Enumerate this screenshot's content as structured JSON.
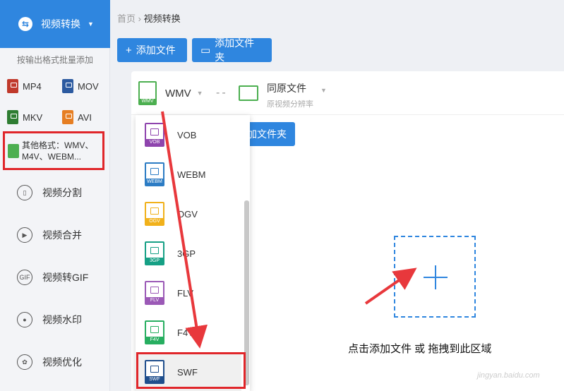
{
  "sidebar": {
    "top_label": "视频转换",
    "hint": "按输出格式批量添加",
    "formats": [
      {
        "label": "MP4",
        "icon": "mp4-icon",
        "color": "#c0392b"
      },
      {
        "label": "MOV",
        "icon": "mov-icon",
        "color": "#2c5aa0"
      },
      {
        "label": "MKV",
        "icon": "mkv-icon",
        "color": "#2e7d32"
      },
      {
        "label": "AVI",
        "icon": "avi-icon",
        "color": "#e67e22"
      }
    ],
    "other_formats_line1": "其他格式：WMV、",
    "other_formats_line2": "M4V、WEBM...",
    "nav": [
      {
        "label": "视频分割",
        "icon": "split-icon"
      },
      {
        "label": "视频合并",
        "icon": "merge-icon"
      },
      {
        "label": "视频转GIF",
        "icon": "gif-icon",
        "icon_text": "GIF"
      },
      {
        "label": "视频水印",
        "icon": "watermark-icon"
      },
      {
        "label": "视频优化",
        "icon": "optimize-icon"
      }
    ]
  },
  "breadcrumb": {
    "home": "首页",
    "current": "视频转换"
  },
  "toolbar": {
    "add_file": "添加文件",
    "add_folder": "添加文件夹",
    "add_folder_partial": "加文件夹"
  },
  "source_format": {
    "label": "WMV",
    "icon_text": "WMV"
  },
  "output": {
    "title": "同原文件",
    "subtitle": "原视频分辨率"
  },
  "dropdown": {
    "items": [
      {
        "label": "VOB",
        "icon_text": "VOB",
        "color": "#8e44ad"
      },
      {
        "label": "WEBM",
        "icon_text": "WEBM",
        "color": "#2c7cc4"
      },
      {
        "label": "OGV",
        "icon_text": "OGV",
        "color": "#f1b11b"
      },
      {
        "label": "3GP",
        "icon_text": "3GP",
        "color": "#16a085"
      },
      {
        "label": "FLV",
        "icon_text": "FLV",
        "color": "#9b59b6"
      },
      {
        "label": "F4V",
        "icon_text": "F4V",
        "color": "#27ae60"
      },
      {
        "label": "SWF",
        "icon_text": "SWF",
        "color": "#1f4e8c"
      }
    ]
  },
  "drop_area": {
    "text": "点击添加文件 或 拖拽到此区域"
  },
  "watermark": "jingyan.baidu.com",
  "colors": {
    "accent": "#2f86df",
    "highlight": "#e0262a"
  }
}
